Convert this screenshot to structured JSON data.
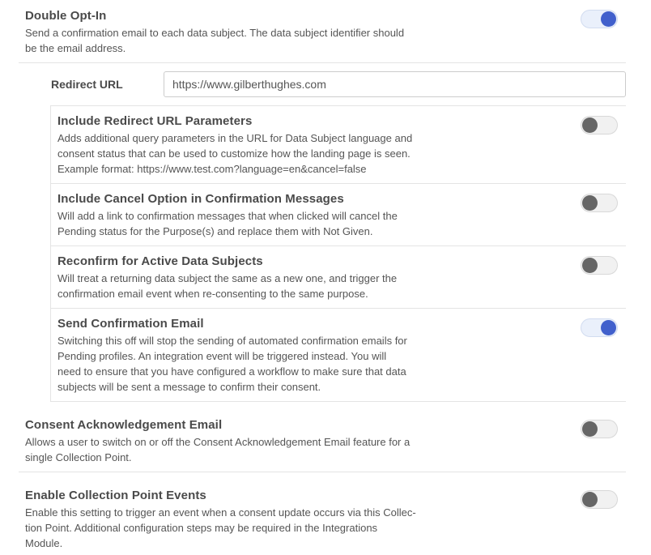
{
  "double_opt_in": {
    "title": "Double Opt-In",
    "desc_lines": [
      "Send a confirmation email to each data subject. The data subject identifier should",
      "be the email address."
    ],
    "enabled": true
  },
  "redirect_url": {
    "label": "Redirect URL",
    "value": "https://www.gilberthughes.com"
  },
  "include_redirect_params": {
    "title": "Include Redirect URL Parameters",
    "desc_lines": [
      "Adds additional query parameters in the URL for Data Subject language and",
      "consent status that can be used to customize how the landing page is seen.",
      "Example format: https://www.test.com?language=en&cancel=false"
    ],
    "enabled": false
  },
  "include_cancel_option": {
    "title": "Include Cancel Option in Confirmation Messages",
    "desc_lines": [
      "Will add a link to confirmation messages that when clicked will cancel the",
      "Pending status for the Purpose(s) and replace them with Not Given."
    ],
    "enabled": false
  },
  "reconfirm_active": {
    "title": "Reconfirm for Active Data Subjects",
    "desc_lines": [
      "Will treat a returning data subject the same as a new one, and trigger the",
      "confirmation email event when re-consenting to the same purpose."
    ],
    "enabled": false
  },
  "send_confirmation": {
    "title": "Send Confirmation Email",
    "desc_lines": [
      "Switching this off will stop the sending of automated confirmation emails for",
      "Pending profiles. An integration event will be triggered instead. You will",
      "need to ensure that you have configured a workflow to make sure that data",
      "subjects will be sent a message to confirm their consent."
    ],
    "enabled": true
  },
  "consent_ack": {
    "title": "Consent Acknowledgement Email",
    "desc_lines": [
      "Allows a user to switch on or off the Consent Acknowledgement Email feature for a",
      "single Collection Point."
    ],
    "enabled": false
  },
  "collection_events": {
    "title": "Enable Collection Point Events",
    "desc_lines": [
      "Enable this setting to trigger an event when a consent update occurs via this Collec-",
      "tion Point. Additional configuration steps may be required in the Integrations",
      "Module."
    ],
    "enabled": false
  }
}
